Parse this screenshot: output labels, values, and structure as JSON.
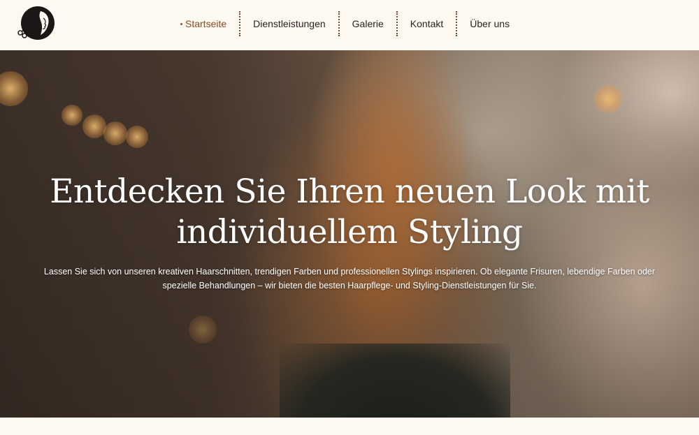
{
  "header": {
    "logo": {
      "icon": "salon-logo-icon"
    },
    "nav": [
      {
        "label": "Startseite",
        "active": true
      },
      {
        "label": "Dienstleistungen",
        "active": false
      },
      {
        "label": "Galerie",
        "active": false
      },
      {
        "label": "Kontakt",
        "active": false
      },
      {
        "label": "Über uns",
        "active": false
      }
    ]
  },
  "hero": {
    "title_line1": "Entdecken Sie Ihren neuen Look mit",
    "title_line2": "individuellem Styling",
    "text_line1": "Lassen Sie sich von unseren kreativen Haarschnitten, trendigen Farben und professionellen Stylings inspirieren. Ob elegante Frisuren, lebendige Farben oder",
    "text_line2": "spezielle Behandlungen – wir bieten die besten Haarpflege- und Styling-Dienstleistungen für Sie."
  },
  "colors": {
    "background": "#fdf9f1",
    "accent": "#8a4b2c",
    "text": "#2b2420"
  }
}
